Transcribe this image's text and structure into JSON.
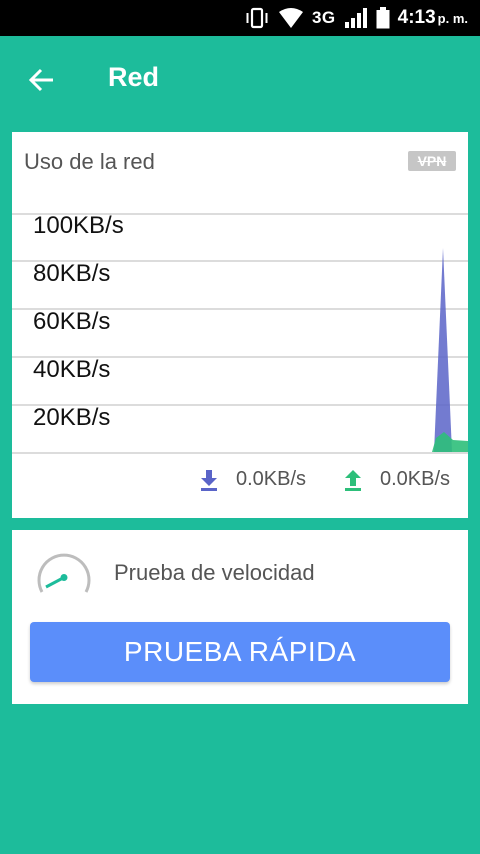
{
  "status_bar": {
    "network_type": "3G",
    "time": "4:13",
    "ampm": "p. m.",
    "icons": [
      "vibrate-icon",
      "wifi-icon",
      "signal-icon",
      "battery-icon"
    ]
  },
  "app_bar": {
    "title": "Red",
    "back_icon": "arrow-back-icon"
  },
  "network_card": {
    "title": "Uso de la red",
    "vpn_badge": "VPN",
    "axis_labels": [
      "100KB/s",
      "80KB/s",
      "60KB/s",
      "40KB/s",
      "20KB/s"
    ],
    "download_speed": "0.0KB/s",
    "upload_speed": "0.0KB/s",
    "colors": {
      "download": "#5a64c8",
      "upload": "#2dbf7a"
    }
  },
  "speed_card": {
    "title": "Prueba de velocidad",
    "button_label": "PRUEBA RÁPIDA",
    "button_color": "#5b8efa"
  },
  "colors": {
    "background": "#1dbc9b"
  }
}
